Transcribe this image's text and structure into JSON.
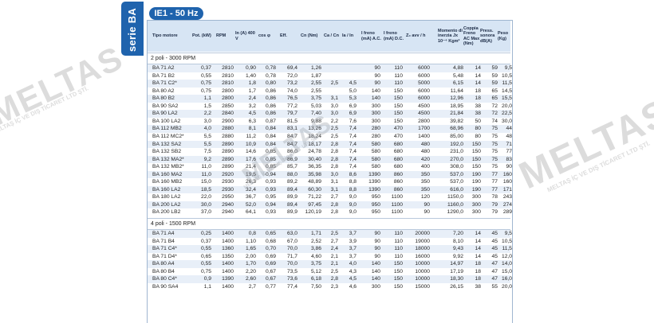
{
  "side_label": "serie BA",
  "badge": "IE1 - 50 Hz",
  "headers": [
    "Tipo motore",
    "Pot. (kW)",
    "RPM",
    "In (A) 400 V",
    "cos φ",
    "Eff.",
    "Cn (Nm)",
    "Ca / Cn",
    "Ia / In",
    "I freno (mA) A.C.",
    "I freno (mA) D.C.",
    "Z₀ avv / h",
    "Momento di inerzia Jx 10⁻⁴ Kgm²",
    "Coppia Freno AC Max (Nm)",
    "Press. sonora dB(A)",
    "Peso (Kg)"
  ],
  "sections": [
    {
      "title": "2 poli - 3000 RPM",
      "rows": [
        [
          "BA 71 A2",
          "0,37",
          "2810",
          "0,90",
          "0,78",
          "69,4",
          "1,26",
          "",
          "",
          "90",
          "110",
          "6000",
          "4,88",
          "14",
          "59",
          "9,5"
        ],
        [
          "BA 71 B2",
          "0,55",
          "2810",
          "1,40",
          "0,78",
          "72,0",
          "1,87",
          "",
          "",
          "90",
          "110",
          "6000",
          "5,48",
          "14",
          "59",
          "10,5"
        ],
        [
          "BA 71 C2*",
          "0,75",
          "2810",
          "1,8",
          "0,80",
          "73,2",
          "2,55",
          "2,5",
          "4,5",
          "90",
          "110",
          "5000",
          "6,15",
          "14",
          "59",
          "11,5"
        ],
        [
          "BA 80 A2",
          "0,75",
          "2800",
          "1,7",
          "0,86",
          "74,0",
          "2,55",
          "",
          "5,0",
          "140",
          "150",
          "6000",
          "11,64",
          "18",
          "65",
          "14,5"
        ],
        [
          "BA 80 B2",
          "1,1",
          "2800",
          "2,4",
          "0,86",
          "76,5",
          "3,75",
          "3,1",
          "5,3",
          "140",
          "150",
          "6000",
          "12,96",
          "18",
          "65",
          "15,5"
        ],
        [
          "BA 90 SA2",
          "1,5",
          "2850",
          "3,2",
          "0,86",
          "77,2",
          "5,03",
          "3,0",
          "6,9",
          "300",
          "150",
          "4500",
          "18,95",
          "38",
          "72",
          "20,0"
        ],
        [
          "BA 90 LA2",
          "2,2",
          "2840",
          "4,5",
          "0,86",
          "79,7",
          "7,40",
          "3,0",
          "6,9",
          "300",
          "150",
          "4500",
          "21,84",
          "38",
          "72",
          "22,5"
        ],
        [
          "BA 100 LA2",
          "3,0",
          "2900",
          "6,3",
          "0,87",
          "81,5",
          "9,88",
          "2,2",
          "7,6",
          "300",
          "150",
          "2800",
          "39,82",
          "50",
          "74",
          "30,0"
        ],
        [
          "BA 112 MB2",
          "4,0",
          "2880",
          "8,1",
          "0,84",
          "83,1",
          "13,26",
          "2,5",
          "7,4",
          "280",
          "470",
          "1700",
          "68,96",
          "80",
          "75",
          "44"
        ],
        [
          "BA 112 MC2*",
          "5,5",
          "2880",
          "11,2",
          "0,84",
          "84,7",
          "18,24",
          "2,5",
          "7,4",
          "280",
          "470",
          "1400",
          "85,00",
          "80",
          "75",
          "48"
        ],
        [
          "BA 132 SA2",
          "5,5",
          "2890",
          "10,9",
          "0,84",
          "84,7",
          "18,17",
          "2,8",
          "7,4",
          "580",
          "680",
          "480",
          "192,0",
          "150",
          "75",
          "71"
        ],
        [
          "BA 132 SB2",
          "7,5",
          "2890",
          "14,6",
          "0,85",
          "86,0",
          "24,78",
          "2,8",
          "7,4",
          "580",
          "680",
          "480",
          "231,0",
          "150",
          "75",
          "77"
        ],
        [
          "BA 132 MA2*",
          "9,2",
          "2890",
          "17,6",
          "0,85",
          "86,9",
          "30,40",
          "2,8",
          "7,4",
          "580",
          "680",
          "420",
          "270,0",
          "150",
          "75",
          "83"
        ],
        [
          "BA 132 MB2*",
          "11,0",
          "2890",
          "21,4",
          "0,85",
          "85,7",
          "36,35",
          "2,8",
          "7,4",
          "580",
          "680",
          "400",
          "308,0",
          "150",
          "75",
          "90"
        ],
        [
          "BA 160 MA2",
          "11,0",
          "2920",
          "19,5",
          "0,94",
          "88,0",
          "35,98",
          "3,0",
          "8,6",
          "1390",
          "860",
          "350",
          "537,0",
          "190",
          "77",
          "160"
        ],
        [
          "BA 160 MB2",
          "15,0",
          "2930",
          "26,3",
          "0,93",
          "89,2",
          "48,89",
          "3,1",
          "8,8",
          "1390",
          "860",
          "350",
          "537,0",
          "190",
          "77",
          "160"
        ],
        [
          "BA 160 LA2",
          "18,5",
          "2930",
          "32,4",
          "0,93",
          "89,4",
          "60,30",
          "3,1",
          "8,8",
          "1390",
          "860",
          "350",
          "616,0",
          "190",
          "77",
          "171"
        ],
        [
          "BA 180 LA2",
          "22,0",
          "2950",
          "36,7",
          "0,95",
          "89,9",
          "71,22",
          "2,7",
          "9,0",
          "950",
          "1100",
          "120",
          "1150,0",
          "300",
          "78",
          "243"
        ],
        [
          "BA 200 LA2",
          "30,0",
          "2940",
          "52,0",
          "0,94",
          "89,4",
          "97,45",
          "2,8",
          "9,0",
          "950",
          "1100",
          "90",
          "1160,0",
          "300",
          "79",
          "274"
        ],
        [
          "BA 200 LB2",
          "37,0",
          "2940",
          "64,1",
          "0,93",
          "89,9",
          "120,19",
          "2,8",
          "9,0",
          "950",
          "1100",
          "90",
          "1290,0",
          "300",
          "79",
          "289"
        ]
      ]
    },
    {
      "title": "4 poli - 1500 RPM",
      "rows": [
        [
          "BA 71 A4",
          "0,25",
          "1400",
          "0,8",
          "0,65",
          "63,0",
          "1,71",
          "2,5",
          "3,7",
          "90",
          "110",
          "20000",
          "7,20",
          "14",
          "45",
          "9,5"
        ],
        [
          "BA 71 B4",
          "0,37",
          "1400",
          "1,10",
          "0,68",
          "67,0",
          "2,52",
          "2,7",
          "3,9",
          "90",
          "110",
          "19000",
          "8,10",
          "14",
          "45",
          "10,5"
        ],
        [
          "BA 71 C4*",
          "0,55",
          "1360",
          "1,65",
          "0,70",
          "70,0",
          "3,86",
          "2,4",
          "3,7",
          "90",
          "110",
          "18000",
          "9,43",
          "14",
          "45",
          "11,5"
        ],
        [
          "BA 71 D4*",
          "0,65",
          "1350",
          "2,00",
          "0,69",
          "71,7",
          "4,60",
          "2,1",
          "3,7",
          "90",
          "110",
          "16000",
          "9,92",
          "14",
          "45",
          "12,0"
        ],
        [
          "BA 80 A4",
          "0,55",
          "1400",
          "1,70",
          "0,69",
          "70,0",
          "3,75",
          "2,1",
          "4,0",
          "140",
          "150",
          "10000",
          "14,97",
          "18",
          "47",
          "14,0"
        ],
        [
          "BA 80 B4",
          "0,75",
          "1400",
          "2,20",
          "0,67",
          "73,5",
          "5,12",
          "2,5",
          "4,3",
          "140",
          "150",
          "10000",
          "17,19",
          "18",
          "47",
          "15,0"
        ],
        [
          "BA 80 C4*",
          "0,9",
          "1390",
          "2,60",
          "0,67",
          "73,6",
          "6,18",
          "2,8",
          "4,5",
          "140",
          "150",
          "10000",
          "18,30",
          "18",
          "47",
          "16,0"
        ],
        [
          "BA 90 SA4",
          "1,1",
          "1400",
          "2,7",
          "0,77",
          "77,4",
          "7,50",
          "2,3",
          "4,6",
          "300",
          "150",
          "15000",
          "26,15",
          "38",
          "55",
          "20,0"
        ]
      ]
    }
  ],
  "watermarks": [
    "MELTAS",
    "MELTAŞ İÇ VE DIŞ TİCARET LTD ŞTİ."
  ]
}
